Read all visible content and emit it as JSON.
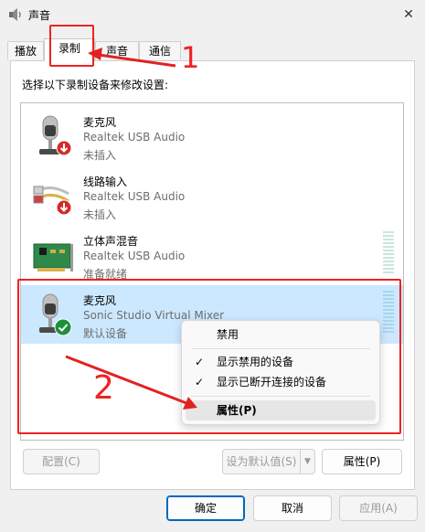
{
  "window": {
    "title": "声音",
    "close_glyph": "✕"
  },
  "tabs": [
    {
      "label": "播放"
    },
    {
      "label": "录制"
    },
    {
      "label": "声音"
    },
    {
      "label": "通信"
    }
  ],
  "instruction": "选择以下录制设备来修改设置:",
  "devices": [
    {
      "name": "麦克风",
      "driver": "Realtek USB Audio",
      "status": "未插入",
      "icon": "microphone-icon",
      "badge": "unplugged-badge-icon"
    },
    {
      "name": "线路输入",
      "driver": "Realtek USB Audio",
      "status": "未插入",
      "icon": "line-in-cable-icon",
      "badge": "unplugged-badge-icon"
    },
    {
      "name": "立体声混音",
      "driver": "Realtek USB Audio",
      "status": "准备就绪",
      "icon": "sound-card-icon",
      "badge": ""
    },
    {
      "name": "麦克风",
      "driver": "Sonic Studio Virtual Mixer",
      "status": "默认设备",
      "icon": "microphone-icon",
      "badge": "default-check-badge-icon"
    }
  ],
  "context_menu": {
    "items": [
      {
        "label": "禁用",
        "checked": false
      },
      {
        "label": "显示禁用的设备",
        "checked": true
      },
      {
        "label": "显示已断开连接的设备",
        "checked": true
      },
      {
        "label": "属性(P)",
        "checked": false
      }
    ],
    "check_glyph": "✓"
  },
  "panel_buttons": {
    "configure": "配置(C)",
    "set_default": "设为默认值(S)",
    "properties": "属性(P)"
  },
  "dialog_buttons": {
    "ok": "确定",
    "cancel": "取消",
    "apply": "应用(A)"
  },
  "annotations": {
    "step1": "1",
    "step2": "2"
  },
  "colors": {
    "annotation_red": "#e22222",
    "selection_blue": "#cce8ff",
    "primary_border": "#0067c0"
  }
}
